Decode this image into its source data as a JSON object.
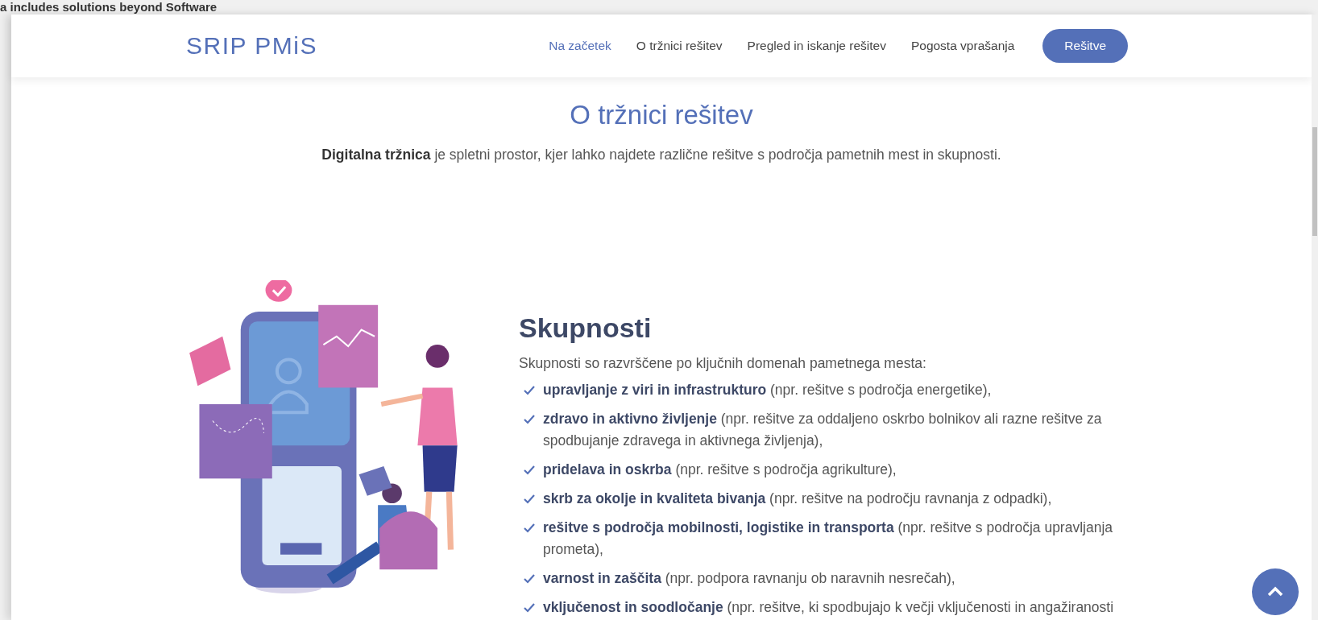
{
  "backdrop_text": "a includes solutions beyond Software",
  "header": {
    "logo": "SRIP PMiS",
    "nav": [
      {
        "label": "Na začetek",
        "selected": true
      },
      {
        "label": "O tržnici rešitev",
        "selected": false
      },
      {
        "label": "Pregled in iskanje rešitev",
        "selected": false
      },
      {
        "label": "Pogosta vprašanja",
        "selected": false
      }
    ],
    "cta_button": "Rešitve"
  },
  "intro": {
    "title": "O tržnici rešitev",
    "text": "**Digitalna tržnica** je spletni prostor, kjer lahko najdete različne rešitve s področja pametnih mest in skupnosti."
  },
  "section": {
    "heading": "Skupnosti",
    "lead": "Skupnosti so razvrščene po ključnih domenah pametnega mesta:",
    "items": [
      "**upravljanje z viri in infrastrukturo** (npr. rešitve s področja energetike),",
      "**zdravo in aktivno življenje** (npr. rešitve za oddaljeno oskrbo bolnikov ali razne rešitve za spodbujanje zdravega in aktivnega življenja),",
      "**pridelava in oskrba** (npr. rešitve s področja agrikulture),",
      "**skrb za okolje in kvaliteta bivanja** (npr. rešitve na področju ravnanja z odpadki),",
      "**rešitve s področja mobilnosti, logistike in transporta** (npr. rešitve s področja upravljanja prometa),",
      "**varnost in zaščita** (npr. podpora ravnanju ob naravnih nesrečah),",
      "**vključenost in soodločanje** (npr. rešitve, ki spodbujajo k večji vključenosti in angažiranosti"
    ]
  }
}
